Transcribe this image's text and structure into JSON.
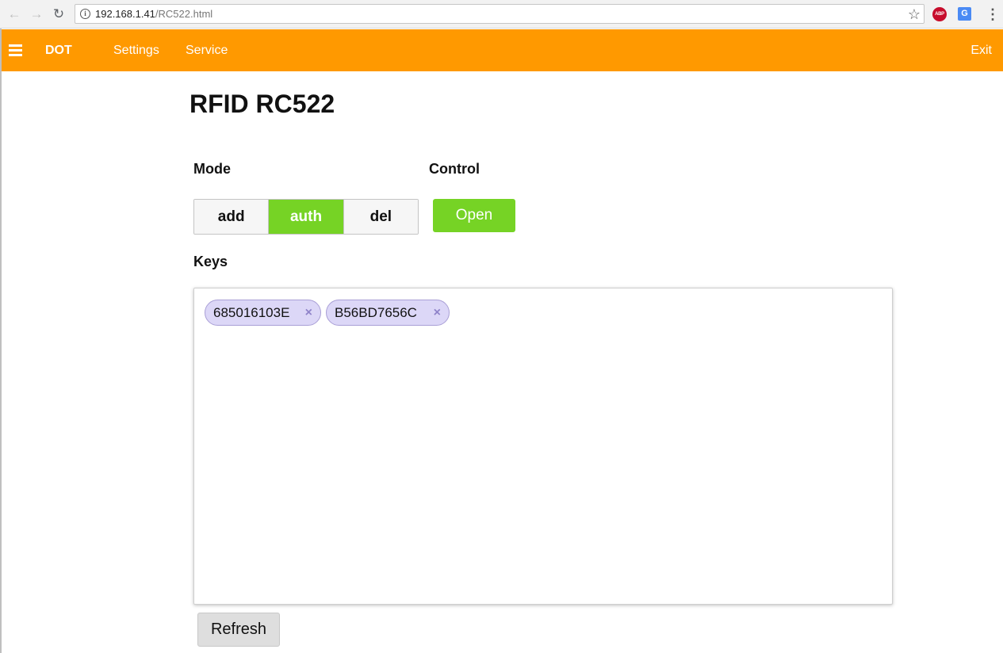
{
  "browser": {
    "url_host": "192.168.1.41",
    "url_path": "/RC522.html",
    "info_icon": "i",
    "back_icon": "←",
    "forward_icon": "→",
    "reload_icon": "↻",
    "star_icon": "☆",
    "abp_label": "ABP",
    "translate_label": "G",
    "menu_icon": "⋮"
  },
  "topnav": {
    "background_color": "#ff9900",
    "brand": "DOT",
    "items": [
      "Settings",
      "Service"
    ],
    "exit": "Exit"
  },
  "page": {
    "title": "RFID RC522",
    "mode_label": "Mode",
    "control_label": "Control",
    "keys_label": "Keys",
    "mode_options": [
      "add",
      "auth",
      "del"
    ],
    "mode_selected": "auth",
    "open_button": "Open",
    "keys": [
      {
        "value": "685016103E",
        "remove": "×"
      },
      {
        "value": "B56BD7656C",
        "remove": "×"
      }
    ],
    "refresh_button": "Refresh",
    "accent_color": "#76d325",
    "tag_color": "#dcd7f7"
  }
}
